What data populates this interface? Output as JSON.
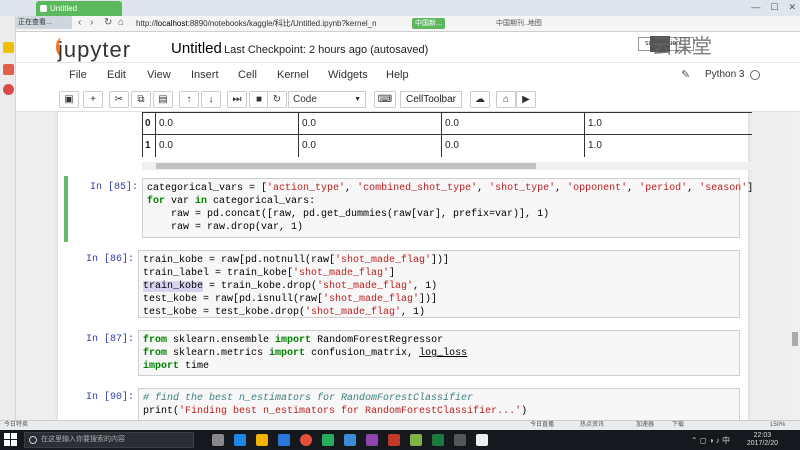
{
  "browser": {
    "tab_title": "Untitled",
    "url_ghost": "正在查看...",
    "url_host": "localhost",
    "url_rest": ":8890/notebooks/kaggle/科比/Untitled.ipynb?kernel_n",
    "green_tag": "中国新...",
    "bookmark": "中国期刊..地图"
  },
  "header": {
    "logo": "jupyter",
    "notebook_title": "Untitled",
    "checkpoint": "Last Checkpoint: 2 hours ago (autosaved)",
    "submission": "submission",
    "watermark": "云课堂"
  },
  "menu": {
    "items": [
      "File",
      "Edit",
      "View",
      "Insert",
      "Cell",
      "Kernel",
      "Widgets",
      "Help"
    ],
    "kernel": "Python 3"
  },
  "toolbar": {
    "cell_type": "Code",
    "celltoolbar": "CellToolbar"
  },
  "dataframe": {
    "rows": [
      {
        "idx": "0",
        "c1": "0.0",
        "c2": "0.0",
        "c3": "0.0",
        "c4": "1.0"
      },
      {
        "idx": "1",
        "c1": "0.0",
        "c2": "0.0",
        "c3": "0.0",
        "c4": "1.0"
      }
    ]
  },
  "cells": [
    {
      "prompt": "In [85]:"
    },
    {
      "prompt": "In [86]:"
    },
    {
      "prompt": "In [87]:"
    },
    {
      "prompt": "In [90]:"
    }
  ],
  "status": {
    "left": "今日特卖",
    "items": [
      "今日直播",
      "热点资讯",
      "加速器",
      "下载",
      "150%"
    ]
  },
  "taskbar": {
    "search": "在这里输入你要搜索的内容",
    "time": "22:03",
    "date": "2017/2/20"
  }
}
